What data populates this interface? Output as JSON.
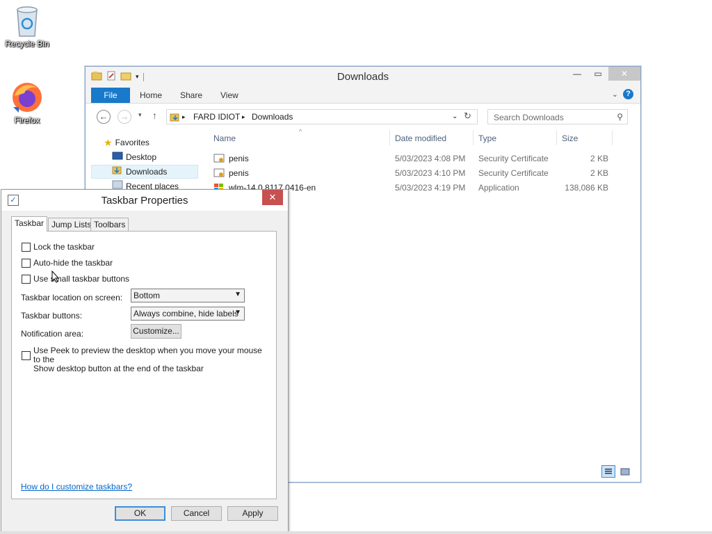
{
  "desktop": {
    "icons": [
      {
        "label": "Recycle Bin"
      },
      {
        "label": "Firefox"
      }
    ]
  },
  "explorer": {
    "title": "Downloads",
    "ribbon": {
      "file": "File",
      "home": "Home",
      "share": "Share",
      "view": "View"
    },
    "address": {
      "crumb1": "FARD IDIOT",
      "crumb2": "Downloads"
    },
    "search_placeholder": "Search Downloads",
    "nav": {
      "favorites": "Favorites",
      "desktop": "Desktop",
      "downloads": "Downloads",
      "recent": "Recent places"
    },
    "columns": {
      "name": "Name",
      "date": "Date modified",
      "type": "Type",
      "size": "Size"
    },
    "files": [
      {
        "name": "penis",
        "date": "5/03/2023 4:08 PM",
        "type": "Security Certificate",
        "size": "2 KB"
      },
      {
        "name": "penis",
        "date": "5/03/2023 4:10 PM",
        "type": "Security Certificate",
        "size": "2 KB"
      },
      {
        "name": "wlm-14.0.8117.0416-en",
        "date": "5/03/2023 4:19 PM",
        "type": "Application",
        "size": "138,086 KB"
      }
    ]
  },
  "dialog": {
    "title": "Taskbar Properties",
    "tabs": {
      "taskbar": "Taskbar",
      "jump": "Jump Lists",
      "toolbars": "Toolbars"
    },
    "lock": "Lock the taskbar",
    "autohide": "Auto-hide the taskbar",
    "small": "Use small taskbar buttons",
    "location_label": "Taskbar location on screen:",
    "location_value": "Bottom",
    "buttons_label": "Taskbar buttons:",
    "buttons_value": "Always combine, hide labels",
    "notif_label": "Notification area:",
    "customize": "Customize...",
    "peek_line1": "Use Peek to preview the desktop when you move your mouse to the",
    "peek_line2": "Show desktop button at the end of the taskbar",
    "help_link": "How do I customize taskbars?",
    "ok": "OK",
    "cancel": "Cancel",
    "apply": "Apply"
  },
  "colors": {
    "accent": "#1979ca",
    "close_red": "#c75050",
    "link": "#0066cc"
  }
}
